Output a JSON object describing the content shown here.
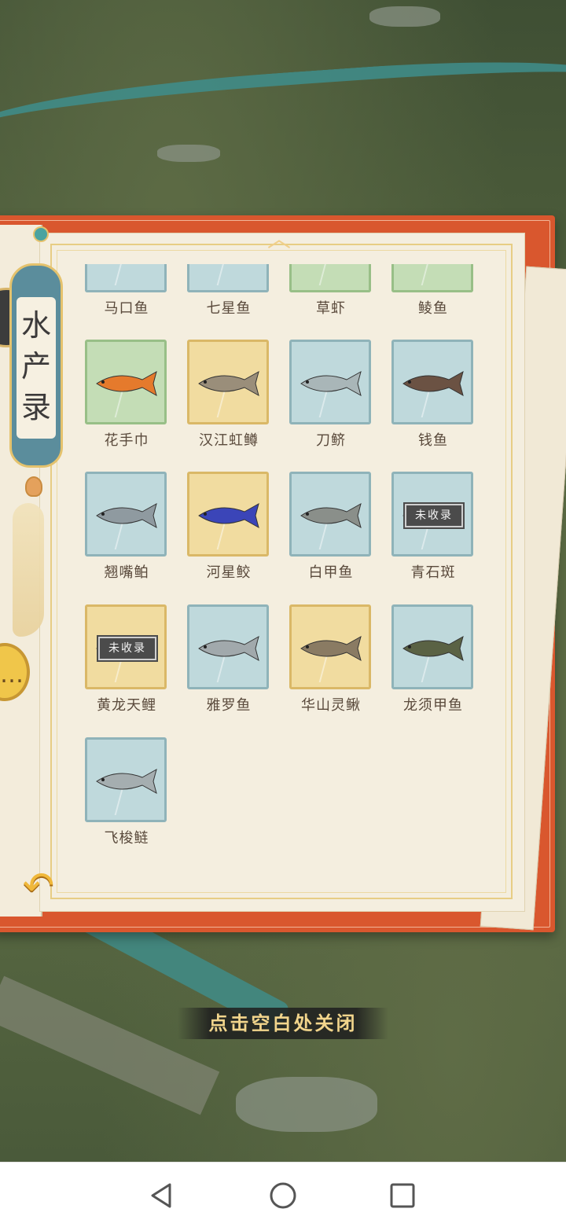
{
  "book": {
    "title": "水产录",
    "up_arrow": "︿",
    "back_arrow": "↶"
  },
  "fish": [
    {
      "name": "马口鱼",
      "color": "blue",
      "locked": false,
      "partial": true
    },
    {
      "name": "七星鱼",
      "color": "blue",
      "locked": false,
      "partial": true
    },
    {
      "name": "草虾",
      "color": "green",
      "locked": false,
      "partial": true
    },
    {
      "name": "鲮鱼",
      "color": "green",
      "locked": false,
      "partial": true
    },
    {
      "name": "花手巾",
      "color": "green",
      "locked": false,
      "fish_color": "#e57a2c"
    },
    {
      "name": "汉江虹鳟",
      "color": "yellow",
      "locked": false,
      "fish_color": "#9a8e7a"
    },
    {
      "name": "刀鲚",
      "color": "blue",
      "locked": false,
      "fish_color": "#a9b6b8"
    },
    {
      "name": "钱鱼",
      "color": "blue",
      "locked": false,
      "fish_color": "#6b5243"
    },
    {
      "name": "翘嘴鲌",
      "color": "blue",
      "locked": false,
      "fish_color": "#8f9aa0"
    },
    {
      "name": "河星鲛",
      "color": "yellow",
      "locked": false,
      "fish_color": "#3b45b8"
    },
    {
      "name": "白甲鱼",
      "color": "blue",
      "locked": false,
      "fish_color": "#8a8f8a"
    },
    {
      "name": "青石斑",
      "color": "blue",
      "locked": true,
      "fish_color": "#5c5c5c"
    },
    {
      "name": "黄龙天鲤",
      "color": "yellow",
      "locked": true,
      "fish_color": "#e8e8e8"
    },
    {
      "name": "雅罗鱼",
      "color": "blue",
      "locked": false,
      "fish_color": "#a1a9ac"
    },
    {
      "name": "华山灵鳅",
      "color": "yellow",
      "locked": false,
      "fish_color": "#8a7b63"
    },
    {
      "name": "龙须甲鱼",
      "color": "blue",
      "locked": false,
      "fish_color": "#5a6244"
    },
    {
      "name": "飞梭鲢",
      "color": "blue",
      "locked": false,
      "fish_color": "#a5aeb0"
    }
  ],
  "locked_label": "未收录",
  "close_hint": "点击空白处关闭",
  "colors": {
    "book_cover": "#d9572e",
    "page": "#f4eedf",
    "gold": "#e7cd84"
  },
  "icons": {
    "nav_back": "triangle-back-icon",
    "nav_home": "circle-home-icon",
    "nav_recent": "square-recent-icon"
  }
}
